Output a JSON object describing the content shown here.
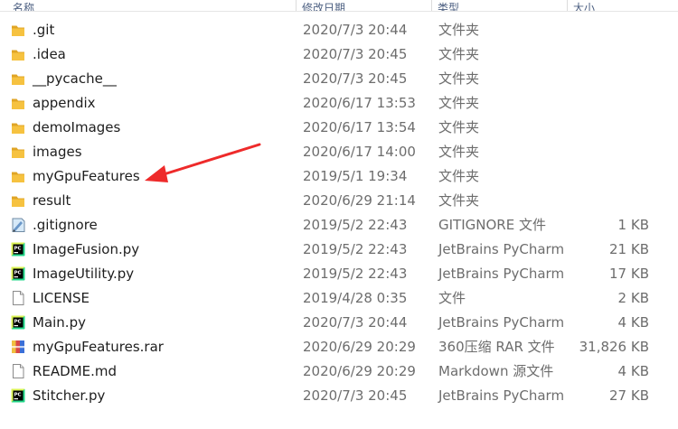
{
  "header": {
    "name_label": "名称",
    "date_label": "修改日期",
    "type_label": "类型",
    "size_label": "大小"
  },
  "files": [
    {
      "name": ".git",
      "date": "2020/7/3 20:44",
      "type": "文件夹",
      "size": "",
      "icon": "folder-icon"
    },
    {
      "name": ".idea",
      "date": "2020/7/3 20:45",
      "type": "文件夹",
      "size": "",
      "icon": "folder-icon"
    },
    {
      "name": "__pycache__",
      "date": "2020/7/3 20:45",
      "type": "文件夹",
      "size": "",
      "icon": "folder-icon"
    },
    {
      "name": "appendix",
      "date": "2020/6/17 13:53",
      "type": "文件夹",
      "size": "",
      "icon": "folder-icon"
    },
    {
      "name": "demoImages",
      "date": "2020/6/17 13:54",
      "type": "文件夹",
      "size": "",
      "icon": "folder-icon"
    },
    {
      "name": "images",
      "date": "2020/6/17 14:00",
      "type": "文件夹",
      "size": "",
      "icon": "folder-icon"
    },
    {
      "name": "myGpuFeatures",
      "date": "2019/5/1 19:34",
      "type": "文件夹",
      "size": "",
      "icon": "folder-icon"
    },
    {
      "name": "result",
      "date": "2020/6/29 21:14",
      "type": "文件夹",
      "size": "",
      "icon": "folder-icon"
    },
    {
      "name": ".gitignore",
      "date": "2019/5/2 22:43",
      "type": "GITIGNORE 文件",
      "size": "1 KB",
      "icon": "notepad-file-icon"
    },
    {
      "name": "ImageFusion.py",
      "date": "2019/5/2 22:43",
      "type": "JetBrains PyCharm",
      "size": "21 KB",
      "icon": "pycharm-file-icon"
    },
    {
      "name": "ImageUtility.py",
      "date": "2019/5/2 22:43",
      "type": "JetBrains PyCharm",
      "size": "17 KB",
      "icon": "pycharm-file-icon"
    },
    {
      "name": "LICENSE",
      "date": "2019/4/28 0:35",
      "type": "文件",
      "size": "2 KB",
      "icon": "blank-file-icon"
    },
    {
      "name": "Main.py",
      "date": "2020/7/3 20:44",
      "type": "JetBrains PyCharm",
      "size": "4 KB",
      "icon": "pycharm-file-icon"
    },
    {
      "name": "myGpuFeatures.rar",
      "date": "2020/6/29 20:29",
      "type": "360压缩 RAR 文件",
      "size": "31,826 KB",
      "icon": "rar-archive-icon"
    },
    {
      "name": "README.md",
      "date": "2020/6/29 20:29",
      "type": "Markdown 源文件",
      "size": "4 KB",
      "icon": "blank-file-icon"
    },
    {
      "name": "Stitcher.py",
      "date": "2020/7/3 20:45",
      "type": "JetBrains PyCharm",
      "size": "27 KB",
      "icon": "pycharm-file-icon"
    }
  ],
  "colors": {
    "folder": "#f6c240",
    "annotation_arrow": "#ee2a2a",
    "secondary_text": "#6d6d6d"
  }
}
